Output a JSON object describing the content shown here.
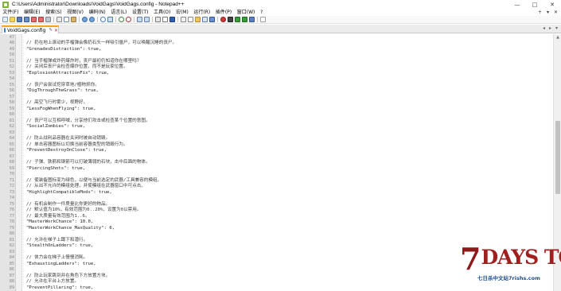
{
  "window": {
    "title": "C:\\Users\\Administrator\\Downloads\\VoidGags\\VoidGags.config - Notepad++",
    "minimize_glyph": "—",
    "maximize_glyph": "□",
    "close_glyph": "✕"
  },
  "menu": {
    "items": [
      "文件(F)",
      "编辑(E)",
      "搜索(S)",
      "视图(V)",
      "编码(N)",
      "语言(L)",
      "设置(T)",
      "工具(O)",
      "宏(M)",
      "运行(R)",
      "插件(P)",
      "窗口(W)",
      "?"
    ],
    "right_controls": [
      "+",
      "▾",
      "✕"
    ]
  },
  "toolbar": {
    "icons": [
      "new-file-icon",
      "open-file-icon",
      "save-icon",
      "save-all-icon",
      "close-icon",
      "close-all-icon",
      "print-icon",
      "cut-icon",
      "copy-icon",
      "paste-icon",
      "undo-icon",
      "redo-icon",
      "find-icon",
      "replace-icon",
      "zoom-in-icon",
      "zoom-out-icon",
      "sync-v-icon",
      "sync-h-icon",
      "word-wrap-icon",
      "all-chars-icon",
      "indent-guide-icon",
      "udl-icon",
      "doc-map-icon",
      "folder-workspace-icon",
      "function-list-icon",
      "monitoring-icon",
      "record-macro-icon",
      "stop-macro-icon",
      "play-macro-icon",
      "play-multi-macro-icon",
      "save-macro-icon",
      "spellcheck-icon"
    ]
  },
  "tab": {
    "label": "VoidGags.config",
    "pin_glyph": "✎",
    "close_glyph": "✕",
    "scroll_left": "◂",
    "scroll_right": "▸",
    "dropdown": "▾"
  },
  "editor": {
    "lines": [
      {
        "n": "47",
        "text": "",
        "type": "blank"
      },
      {
        "n": "48",
        "text": "// 扔在地上滚动的手榴弹会像扔石头一样吸引僵尸，可以唤醒沉睡的丧尸。",
        "type": "comment"
      },
      {
        "n": "49",
        "text": "\"GrenadesDistraction\": true,",
        "type": "kv"
      },
      {
        "n": "50",
        "text": "",
        "type": "blank"
      },
      {
        "n": "51",
        "text": "// 当手榴弹或炸药爆炸时，丧尸最初仍知道你在哪里吗？",
        "type": "comment"
      },
      {
        "n": "52",
        "text": "// 关闭后丧尸会检查爆炸位置，而不是玩家位置。",
        "type": "comment"
      },
      {
        "n": "53",
        "text": "\"ExplosionAttractionFix\": true,",
        "type": "kv"
      },
      {
        "n": "54",
        "text": "",
        "type": "blank"
      },
      {
        "n": "55",
        "text": "// 丧尸会尝试挖穿草地/植物抓你。",
        "type": "comment"
      },
      {
        "n": "56",
        "text": "\"DigThroughTheGrass\": true,",
        "type": "kv"
      },
      {
        "n": "57",
        "text": "",
        "type": "blank"
      },
      {
        "n": "58",
        "text": "// 高空飞行时雾少，视野好。",
        "type": "comment"
      },
      {
        "n": "59",
        "text": "\"LessFogWhenFlying\": true,",
        "type": "kv"
      },
      {
        "n": "60",
        "text": "",
        "type": "blank"
      },
      {
        "n": "61",
        "text": "// 丧尸可以互相呼喊，分享他们攻击或检查某个位置的意图。",
        "type": "comment"
      },
      {
        "n": "62",
        "text": "\"SocialZombies\": true,",
        "type": "kv"
      },
      {
        "n": "63",
        "text": "",
        "type": "blank"
      },
      {
        "n": "64",
        "text": "// 防止战利品容器在关闭时被自动销毁。",
        "type": "comment"
      },
      {
        "n": "65",
        "text": "// 单击容器图标以切换当前容器类型的销毁行为。",
        "type": "comment"
      },
      {
        "n": "66",
        "text": "\"PreventDestroyOnClose\": true,",
        "type": "kv"
      },
      {
        "n": "67",
        "text": "",
        "type": "blank"
      },
      {
        "n": "68",
        "text": "// 子弹、铁箭和钢箭可以打破薄弱的石块，击中后面的物体。",
        "type": "comment"
      },
      {
        "n": "69",
        "text": "\"PiercingShots\": true,",
        "type": "kv"
      },
      {
        "n": "70",
        "text": "",
        "type": "blank"
      },
      {
        "n": "71",
        "text": "// 使装备图标变为绿色，以便与当前选定的武器/工具兼容的模组。",
        "type": "comment"
      },
      {
        "n": "72",
        "text": "// 从出不允许的模组处理，并使模组在武器窗口中可点击。",
        "type": "comment"
      },
      {
        "n": "73",
        "text": "\"HighlightCompatibleMods\": true,",
        "type": "kv"
      },
      {
        "n": "74",
        "text": "",
        "type": "blank"
      },
      {
        "n": "75",
        "text": "// 有机会制作一件质量比你更好的物品。",
        "type": "comment"
      },
      {
        "n": "76",
        "text": "// 默认值为10%，有效范围为0..20%，设置为0以禁用。",
        "type": "comment"
      },
      {
        "n": "77",
        "text": "// 最大质量有效范围为1..6。",
        "type": "comment"
      },
      {
        "n": "78",
        "text": "\"MasterWorkChance\": 10.0,",
        "type": "kv"
      },
      {
        "n": "79",
        "text": "\"MasterWorkChance_MaxQuality\": 6,",
        "type": "kv"
      },
      {
        "n": "80",
        "text": "",
        "type": "blank"
      },
      {
        "n": "81",
        "text": "// 允许在梯子上蹲下和潜行。",
        "type": "comment"
      },
      {
        "n": "82",
        "text": "\"StealthOnLadders\": true,",
        "type": "kv"
      },
      {
        "n": "83",
        "text": "",
        "type": "blank"
      },
      {
        "n": "84",
        "text": "// 体力会在梯子上慢慢消耗。",
        "type": "comment"
      },
      {
        "n": "85",
        "text": "\"ExhaustingLadders\": true,",
        "type": "kv"
      },
      {
        "n": "86",
        "text": "",
        "type": "blank"
      },
      {
        "n": "87",
        "text": "// 防止玩家跳到并在角色下方放置方块。",
        "type": "comment"
      },
      {
        "n": "88",
        "text": "// 允许在平台上方放置。",
        "type": "comment"
      },
      {
        "n": "89",
        "text": "\"PreventPillaring\": true,",
        "type": "kv"
      }
    ]
  },
  "scrollbar": {
    "up_glyph": "▲",
    "thumb_fraction_top": 0.32,
    "thumb_fraction_size": 0.29
  },
  "watermark": {
    "seven": "7",
    "main": "DAYS TO DIE",
    "sub": "七日杀中文站7rishs.com"
  },
  "colors": {
    "tab_accent": "#f5a623",
    "watermark_red": "#a02020",
    "watermark_blue": "#1f4f8a"
  }
}
